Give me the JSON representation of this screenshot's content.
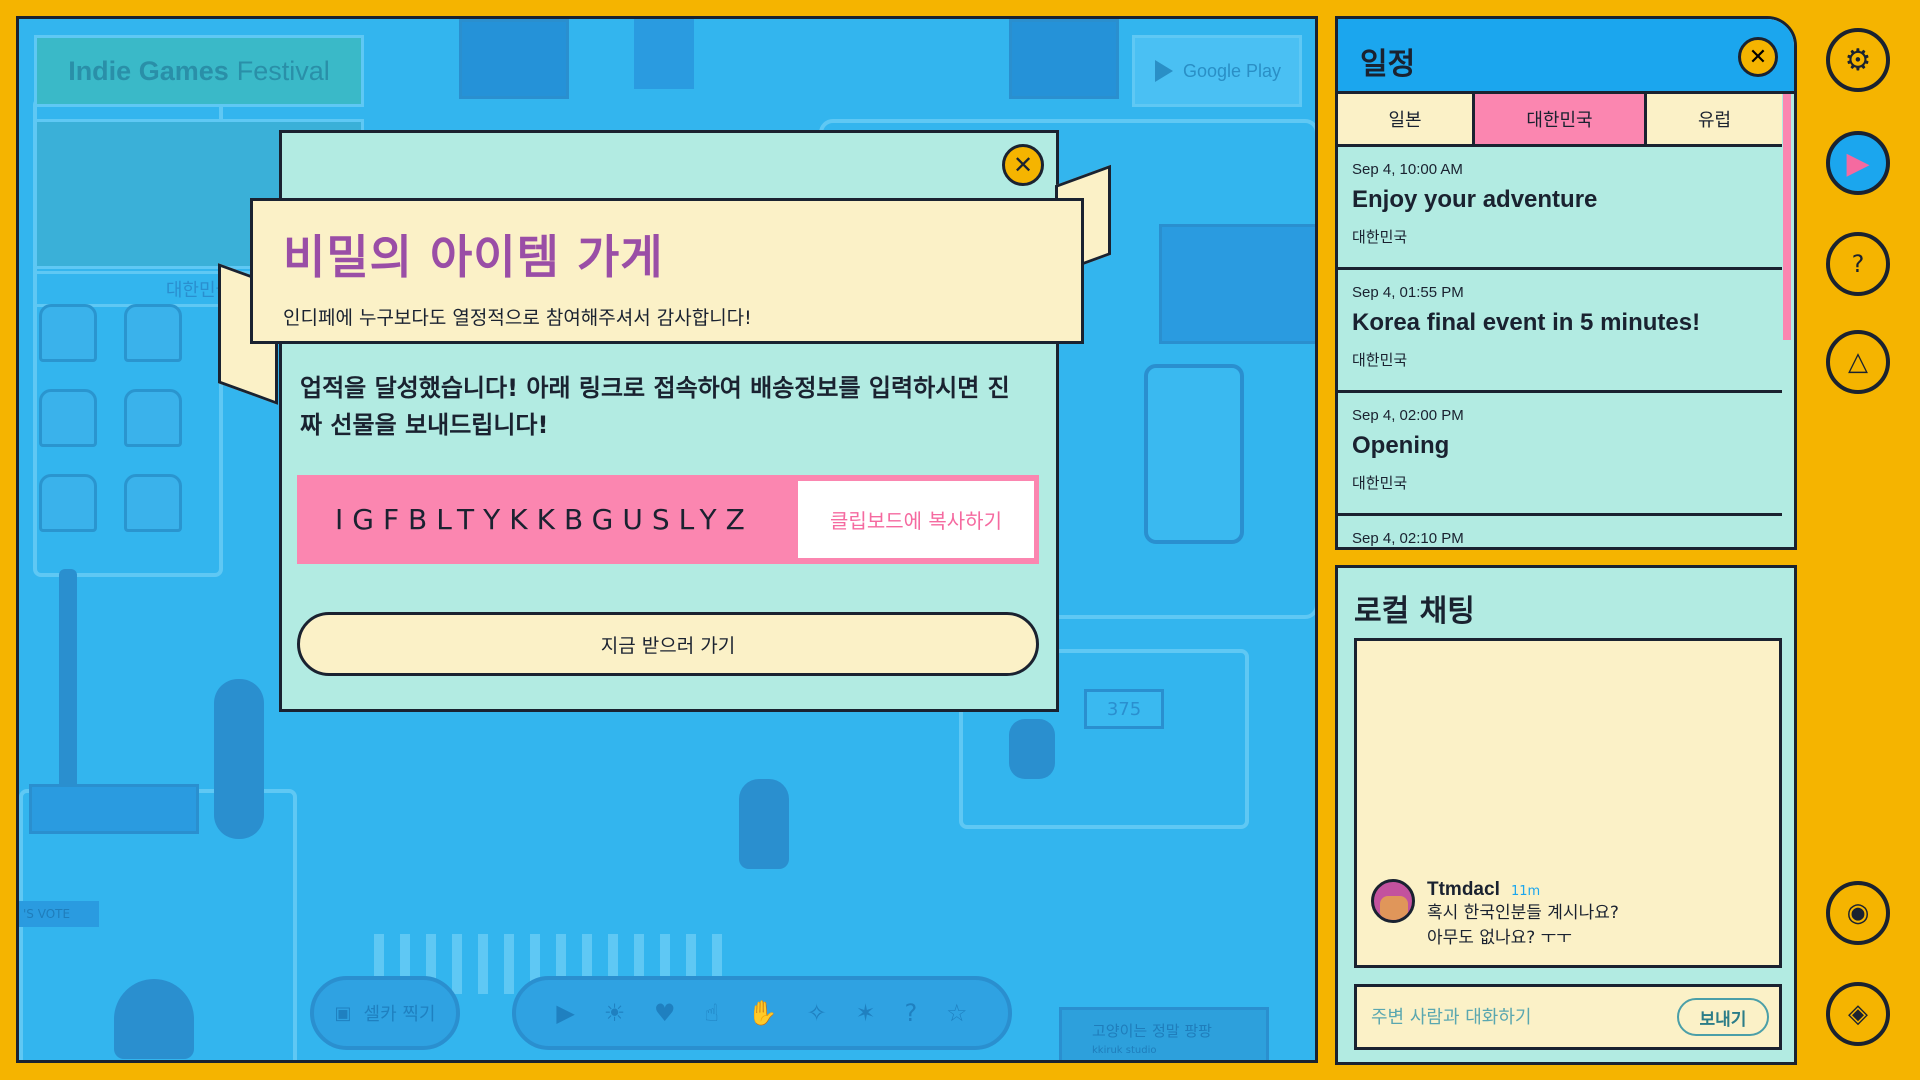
{
  "game": {
    "festival_title_bold": "Indie Games",
    "festival_title_light": "Festival",
    "google_play": "Google Play",
    "country_sign": "대한민국",
    "booth_score": "375",
    "vote_sign": "'S VOTE",
    "selfie_label": "셀카 찍기",
    "cat_banner": "고양이는 정말 팡팡",
    "cat_banner_sub": "kkiruk studio"
  },
  "modal": {
    "title": "비밀의 아이템 가게",
    "subtitle": "인디페에 누구보다도 열정적으로 참여해주셔서 감사합니다!",
    "body": "업적을 달성했습니다! 아래 링크로 접속하여 배송정보를 입력하시면 진짜 선물을 보내드립니다!",
    "code": "IGFBLTYKKBGUSLYZ",
    "copy_button": "클립보드에 복사하기",
    "go_button": "지금 받으러 가기"
  },
  "schedule": {
    "title": "일정",
    "tabs": [
      {
        "label": "일본",
        "active": false
      },
      {
        "label": "대한민국",
        "active": true
      },
      {
        "label": "유럽",
        "active": false
      }
    ],
    "events": [
      {
        "time": "Sep 4, 10:00 AM",
        "title": "Enjoy your adventure",
        "location": "대한민국"
      },
      {
        "time": "Sep 4, 01:55 PM",
        "title": "Korea final event in 5 minutes!",
        "location": "대한민국"
      },
      {
        "time": "Sep 4, 02:00 PM",
        "title": "Opening",
        "location": "대한민국"
      },
      {
        "time": "Sep 4, 02:10 PM",
        "title": "",
        "location": ""
      }
    ]
  },
  "chat": {
    "title": "로컬 채팅",
    "messages": [
      {
        "user": "Ttmdacl",
        "ago": "11m",
        "lines": [
          "혹시 한국인분들 계시나요?",
          "아무도 없나요? ㅜㅜ"
        ]
      }
    ],
    "input_placeholder": "주변 사람과 대화하기",
    "send_button": "보내기"
  },
  "side_icons": [
    "gear-icon",
    "video-icon",
    "question-card-icon",
    "hanger-icon",
    "camera-icon",
    "map-icon"
  ],
  "colors": {
    "frame": "#f5b400",
    "game_bg": "#33b5ee",
    "panel": "#b2ebe2",
    "cream": "#fbf1c7",
    "pink": "#fb86b0",
    "purple_title": "#9a4ea6",
    "header_blue": "#1ba6ee"
  }
}
